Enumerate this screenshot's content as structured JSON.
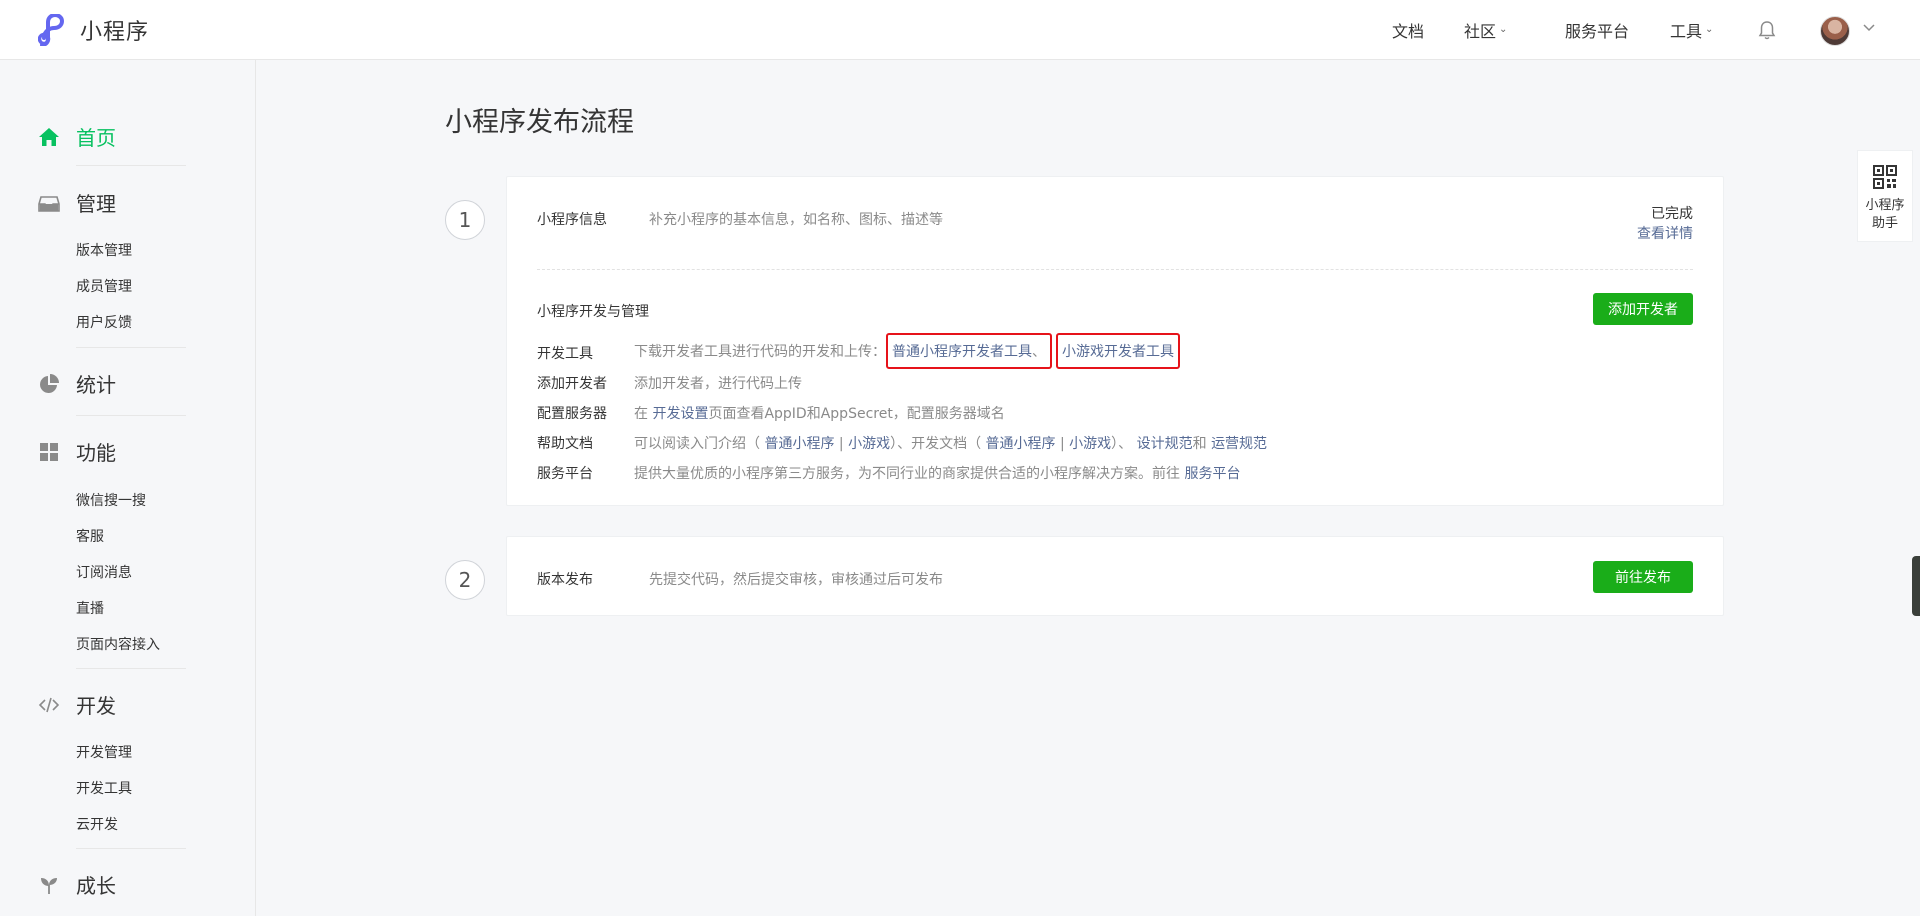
{
  "header": {
    "brand_name": "小程序",
    "nav": [
      {
        "label": "文档",
        "has_dropdown": false
      },
      {
        "label": "社区",
        "has_dropdown": true
      },
      {
        "label": "服务平台",
        "has_dropdown": false
      },
      {
        "label": "工具",
        "has_dropdown": true
      }
    ],
    "icons": [
      "brand-logo-icon",
      "bell-icon",
      "avatar",
      "chevron-down-icon"
    ]
  },
  "sidebar": {
    "groups": [
      {
        "label": "首页",
        "icon": "home-icon",
        "active": true,
        "items": []
      },
      {
        "label": "管理",
        "icon": "inbox-icon",
        "items": [
          "版本管理",
          "成员管理",
          "用户反馈"
        ]
      },
      {
        "label": "统计",
        "icon": "pie-chart-icon",
        "items": []
      },
      {
        "label": "功能",
        "icon": "grid-icon",
        "items": [
          "微信搜一搜",
          "客服",
          "订阅消息",
          "直播",
          "页面内容接入"
        ]
      },
      {
        "label": "开发",
        "icon": "code-icon",
        "items": [
          "开发管理",
          "开发工具",
          "云开发"
        ]
      },
      {
        "label": "成长",
        "icon": "sprout-icon",
        "items": []
      }
    ]
  },
  "main": {
    "title": "小程序发布流程",
    "steps": [
      {
        "number": "1",
        "info": {
          "title": "小程序信息",
          "desc": "补充小程序的基本信息，如名称、图标、描述等",
          "status": "已完成",
          "status_link": "查看详情"
        },
        "dev": {
          "title": "小程序开发与管理",
          "button": "添加开发者",
          "rows": [
            {
              "label": "开发工具",
              "pre": "下载开发者工具进行代码的开发和上传：",
              "link1": "普通小程序开发者工具",
              "sep": "、",
              "link2": "小游戏开发者工具"
            },
            {
              "label": "添加开发者",
              "text": "添加开发者，进行代码上传"
            },
            {
              "label": "配置服务器",
              "pre": "在 ",
              "link": "开发设置",
              "post": "页面查看AppID和AppSecret，配置服务器域名"
            },
            {
              "label": "帮助文档",
              "pre": "可以阅读入门介绍（ ",
              "l1": "普通小程序",
              "bar": " | ",
              "l2": "小游戏",
              "mid": "）、开发文档（ ",
              "l3": "普通小程序",
              "l4": "小游戏",
              "mid2": "）、 ",
              "l5": "设计规范",
              "and": "和 ",
              "l6": "运营规范"
            },
            {
              "label": "服务平台",
              "pre": "提供大量优质的小程序第三方服务，为不同行业的商家提供合适的小程序解决方案。前往 ",
              "link": "服务平台"
            }
          ]
        }
      },
      {
        "number": "2",
        "title": "版本发布",
        "desc": "先提交代码，然后提交审核，审核通过后可发布",
        "button": "前往发布"
      }
    ]
  },
  "assistant": {
    "label_line1": "小程序",
    "label_line2": "助手",
    "icon": "qr-code-icon"
  },
  "colors": {
    "green": "#07c160",
    "button_green": "#1aad19",
    "link": "#576b95",
    "highlight_red": "#e6131a"
  }
}
